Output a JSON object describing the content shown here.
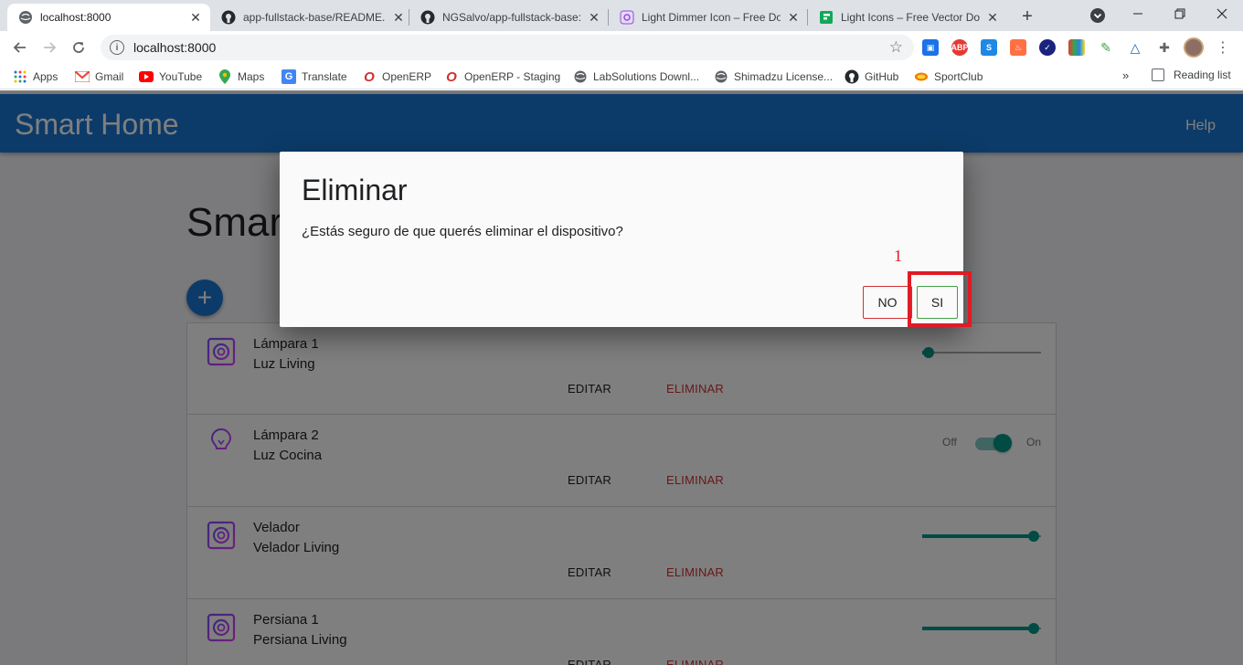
{
  "browser": {
    "tabs": [
      {
        "title": "localhost:8000",
        "favicon": "globe-icon",
        "active": true
      },
      {
        "title": "app-fullstack-base/README.m",
        "favicon": "github-icon",
        "active": false
      },
      {
        "title": "NGSalvo/app-fullstack-base:",
        "favicon": "github-icon",
        "active": false
      },
      {
        "title": "Light Dimmer Icon – Free Do",
        "favicon": "iconscout-icon",
        "active": false
      },
      {
        "title": "Light Icons – Free Vector Dov",
        "favicon": "flaticon-icon",
        "active": false
      }
    ],
    "new_tab": "+",
    "address": "localhost:8000",
    "bookmarks": [
      {
        "label": "Apps",
        "icon": "apps-grid-icon"
      },
      {
        "label": "Gmail",
        "icon": "gmail-icon"
      },
      {
        "label": "YouTube",
        "icon": "youtube-icon"
      },
      {
        "label": "Maps",
        "icon": "maps-icon"
      },
      {
        "label": "Translate",
        "icon": "translate-icon"
      },
      {
        "label": "OpenERP",
        "icon": "opera-icon"
      },
      {
        "label": "OpenERP - Staging",
        "icon": "opera-icon"
      },
      {
        "label": "LabSolutions Downl...",
        "icon": "globe-icon"
      },
      {
        "label": "Shimadzu License...",
        "icon": "globe-icon"
      },
      {
        "label": "GitHub",
        "icon": "github-icon"
      },
      {
        "label": "SportClub",
        "icon": "sportclub-icon"
      }
    ],
    "bookmarks_more": "»",
    "reading_list": "Reading list"
  },
  "app": {
    "title": "Smart Home",
    "help": "Help",
    "heading": "Smart Home",
    "add_button": "+"
  },
  "devices": [
    {
      "name": "Lámpara 1",
      "description": "Luz Living",
      "icon": "dimmer-icon",
      "control": "slider",
      "level": 0.05,
      "edit": "EDITAR",
      "delete": "ELIMINAR"
    },
    {
      "name": "Lámpara 2",
      "description": "Luz Cocina",
      "icon": "lightbulb-icon",
      "control": "switch",
      "state": "On",
      "off_label": "Off",
      "on_label": "On",
      "edit": "EDITAR",
      "delete": "ELIMINAR"
    },
    {
      "name": "Velador",
      "description": "Velador Living",
      "icon": "dimmer-icon",
      "control": "slider",
      "level": 0.94,
      "edit": "EDITAR",
      "delete": "ELIMINAR"
    },
    {
      "name": "Persiana 1",
      "description": "Persiana Living",
      "icon": "dimmer-icon",
      "control": "slider",
      "level": 0.94,
      "edit": "EDITAR",
      "delete": "ELIMINAR"
    }
  ],
  "dialog": {
    "title": "Eliminar",
    "message": "¿Estás seguro de que querés eliminar el dispositivo?",
    "no_label": "NO",
    "yes_label": "SI"
  },
  "annotation": {
    "step": "1",
    "color": "#e01b24"
  },
  "colors": {
    "primary": "#1976d2",
    "accent": "#009688",
    "danger": "#d32f2f"
  }
}
